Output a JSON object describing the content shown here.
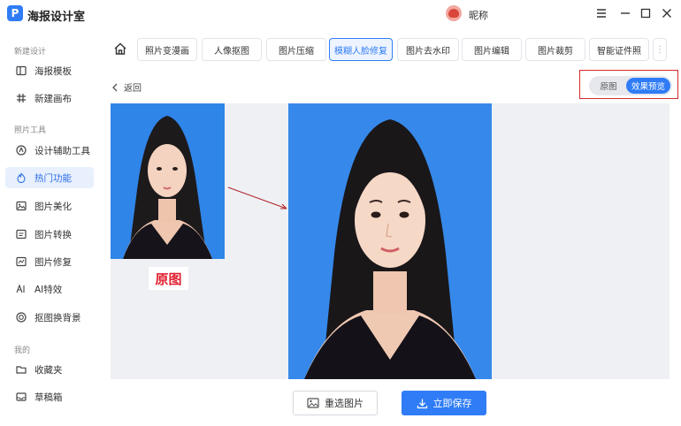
{
  "app": {
    "logo_letter": "P",
    "title": "海报设计室",
    "nickname": "昵称"
  },
  "window_controls": [
    "menu-icon",
    "minimize-icon",
    "maximize-icon",
    "close-icon"
  ],
  "sidebar": {
    "sections": [
      {
        "title": "新建设计",
        "items": [
          {
            "label": "海报模板",
            "icon": "template-icon"
          },
          {
            "label": "新建画布",
            "icon": "canvas-icon"
          }
        ]
      },
      {
        "title": "照片工具",
        "items": [
          {
            "label": "设计辅助工具",
            "icon": "compass-icon"
          },
          {
            "label": "热门功能",
            "icon": "flame-icon",
            "active": true
          },
          {
            "label": "图片美化",
            "icon": "image-beauty-icon"
          },
          {
            "label": "图片转换",
            "icon": "convert-icon"
          },
          {
            "label": "图片修复",
            "icon": "repair-icon"
          },
          {
            "label": "AI特效",
            "icon": "ai-icon"
          },
          {
            "label": "抠图换背景",
            "icon": "cutout-icon"
          }
        ]
      },
      {
        "title": "我的",
        "items": [
          {
            "label": "收藏夹",
            "icon": "folder-icon"
          },
          {
            "label": "草稿箱",
            "icon": "draft-icon"
          }
        ]
      }
    ]
  },
  "tabs": [
    {
      "label": "照片变漫画"
    },
    {
      "label": "人像抠图"
    },
    {
      "label": "图片压缩"
    },
    {
      "label": "模糊人脸修复",
      "active": true
    },
    {
      "label": "图片去水印"
    },
    {
      "label": "图片编辑"
    },
    {
      "label": "图片裁剪"
    },
    {
      "label": "智能证件照"
    }
  ],
  "back_label": "返回",
  "view_toggle": {
    "original": "原图",
    "preview": "效果预览",
    "selected": "效果预览"
  },
  "original_caption": "原图",
  "buttons": {
    "reselect": "重选图片",
    "save": "立即保存"
  },
  "colors": {
    "accent": "#2f7cf6",
    "photo_bg": "#3689ea",
    "highlight": "#d42a2a",
    "caption_red": "#e0202e"
  }
}
